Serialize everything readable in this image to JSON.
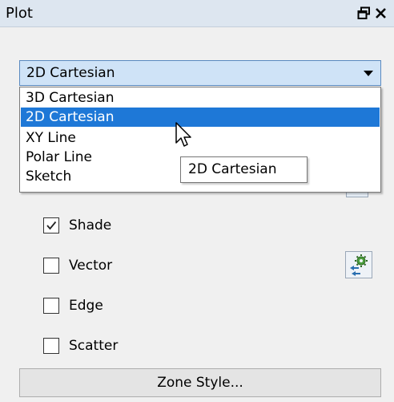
{
  "panel": {
    "title": "Plot",
    "float_icon": "float-window-icon",
    "close_icon": "close-icon"
  },
  "plot_type": {
    "selected": "2D Cartesian",
    "options": [
      "3D Cartesian",
      "2D Cartesian",
      "XY Line",
      "Polar Line",
      "Sketch"
    ],
    "highlighted": "2D Cartesian",
    "tooltip": "2D Cartesian"
  },
  "layers": [
    {
      "label": "Shade",
      "checked": true
    },
    {
      "label": "Vector",
      "checked": false
    },
    {
      "label": "Edge",
      "checked": false
    },
    {
      "label": "Scatter",
      "checked": false
    }
  ],
  "vector_settings_icon": "gear-arrows-icon",
  "zone_style_label": "Zone Style...",
  "colors": {
    "title_bar": "#dde6f0",
    "selection": "#1e78d7",
    "combo_bg": "#cfe3f7",
    "panel_bg": "#f0f0f0"
  }
}
